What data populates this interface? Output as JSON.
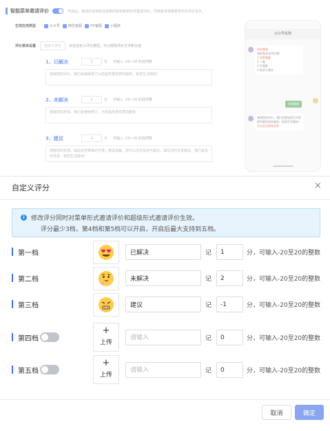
{
  "background": {
    "section_title": "智能菜单邀请评价",
    "section_desc": "开启后，接话的咨询将在结束时收到菜单形式邀请评价，同电表单将做菜单形式评价显示。",
    "channel_label": "生效应用类型",
    "channels": [
      "公众号",
      "微信客服",
      "H5客服",
      "小程序"
    ],
    "menu_label": "评价菜单设置",
    "custom_btn": "自定义评分",
    "menu_hint": "点击自定义评分按钮，可以修改评价文字和分值",
    "levels": [
      {
        "name": "1、已解决",
        "score": "1",
        "unit": "分",
        "hint": "可输入 -20~20 的自然数",
        "text": "感谢您的评价，我们会继续努力为您提供更优质的服务，祝您生活愉快！"
      },
      {
        "name": "2、未解决",
        "score": "2",
        "unit": "分",
        "hint": "可输入 -20~20 的自然数",
        "text": "感谢您的反馈。我们会继续努力，为您提供更优质的服务"
      },
      {
        "name": "3、建议",
        "score": "-1",
        "unit": "分",
        "hint": "可输入 -20~20 的自然数",
        "text": "感谢您的反馈，由此给您带来的不便，敬请谅解，您可以点击投诉与建议，填写您的宝贵建议，我们会及时改进，祝您生活愉快！"
      }
    ],
    "phone": {
      "title": "公众号名称",
      "msg1": "评价邀请",
      "msg2": "请给我本次评价吧！",
      "opts": [
        "1.非常满意",
        "2.一般",
        "3.不满意",
        "4.投诉与建议"
      ],
      "green": "非常满意",
      "note": "感谢您的评价，我们会更加努力为您提供更优质的服务，祝您生活愉快！",
      "notes_red": [
        "点击后比菜单文案"
      ]
    }
  },
  "modal": {
    "title": "自定义评分",
    "close": "×",
    "alert_line1": "修改评分同时对菜单形式邀请评价和超级形式邀请评价生效。",
    "alert_line2": "评分最少3档，第4档和第5档可以开启，开启后最大支持到五档。",
    "score_unit_prefix": "记",
    "rows": [
      {
        "label": "第一档",
        "emoji": "😍",
        "name": "已解决",
        "score": "1",
        "hint": "分，可输入-20至20的整数",
        "toggle": false
      },
      {
        "label": "第二档",
        "emoji": "🤔",
        "name": "未解决",
        "score": "2",
        "hint": "分，可输入-20至20的整数",
        "toggle": false
      },
      {
        "label": "第三档",
        "emoji": "😤",
        "name": "建议",
        "score": "-1",
        "hint": "分，可输入-20至20的整数",
        "toggle": false
      },
      {
        "label": "第四档",
        "upload_plus": "+",
        "upload": "上传",
        "name": "",
        "placeholder": "请输入",
        "score": "0",
        "hint": "分，可输入-20至20的整数",
        "toggle": true
      },
      {
        "label": "第五档",
        "upload_plus": "+",
        "upload": "上传",
        "name": "",
        "placeholder": "请输入",
        "score": "0",
        "hint": "分，可输入-20至20的整数",
        "toggle": true
      }
    ],
    "cancel": "取消",
    "ok": "确定"
  }
}
